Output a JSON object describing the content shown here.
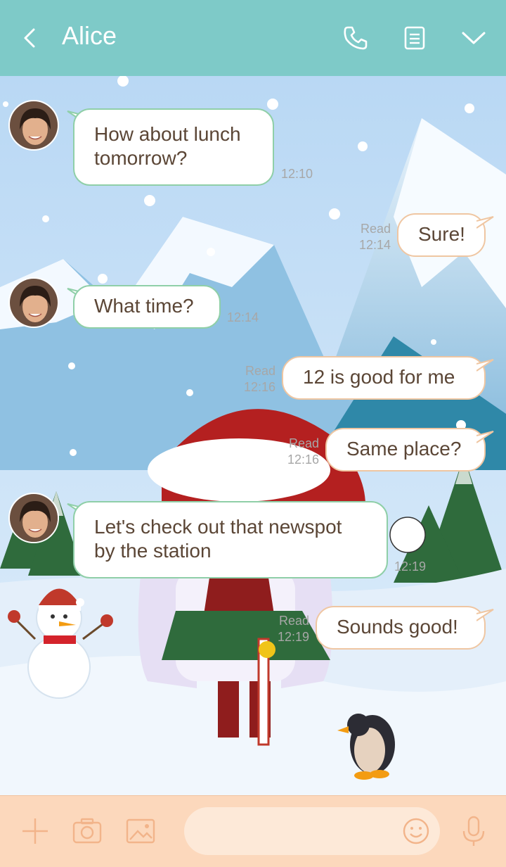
{
  "header": {
    "title": "Alice",
    "icons": [
      "back-arrow-icon",
      "phone-icon",
      "notes-icon",
      "chevron-down-icon"
    ]
  },
  "messages": [
    {
      "id": "m1",
      "direction": "incoming",
      "lines": [
        "How about lunch",
        "tomorrow?"
      ],
      "time": "12:10"
    },
    {
      "id": "m2",
      "direction": "outgoing",
      "lines": [
        "Sure!"
      ],
      "read": "Read",
      "time": "12:14"
    },
    {
      "id": "m3",
      "direction": "incoming",
      "lines": [
        "What time?"
      ],
      "time": "12:14"
    },
    {
      "id": "m4",
      "direction": "outgoing",
      "lines": [
        "12 is good for me"
      ],
      "read": "Read",
      "time": "12:16"
    },
    {
      "id": "m5",
      "direction": "outgoing",
      "lines": [
        "Same place?"
      ],
      "read": "Read",
      "time": "12:16"
    },
    {
      "id": "m6",
      "direction": "incoming",
      "lines": [
        "Let's check out that newspot",
        "by the station"
      ],
      "time": "12:19"
    },
    {
      "id": "m7",
      "direction": "outgoing",
      "lines": [
        "Sounds good!"
      ],
      "read": "Read",
      "time": "12:19"
    }
  ],
  "footer": {
    "icons": [
      "plus-icon",
      "camera-icon",
      "image-icon",
      "emoji-icon",
      "microphone-icon"
    ],
    "input_value": ""
  },
  "colors": {
    "header": "#7ecac8",
    "footer": "#fcd8bc",
    "incoming_border": "#8fcfa8",
    "outgoing_border": "#efc6a2",
    "text": "#5b4636"
  }
}
